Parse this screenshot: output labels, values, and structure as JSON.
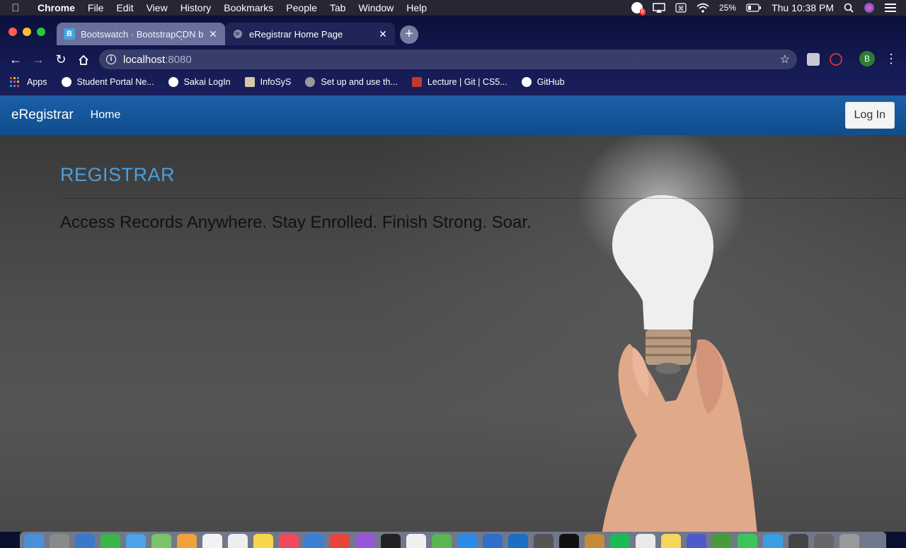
{
  "menubar": {
    "app": "Chrome",
    "items": [
      "File",
      "Edit",
      "View",
      "History",
      "Bookmarks",
      "People",
      "Tab",
      "Window",
      "Help"
    ],
    "battery": "25%",
    "clock": "Thu 10:38 PM",
    "notification_count": "6"
  },
  "tabs": [
    {
      "title": "Bootswatch · BootstrapCDN by",
      "favicon": "B"
    },
    {
      "title": "eRegistrar Home Page"
    }
  ],
  "toolbar": {
    "url_host": "localhost",
    "url_port": ":8080",
    "profile_initial": "B"
  },
  "bookmarks": [
    "Apps",
    "Student Portal Ne...",
    "Sakai LogIn",
    "InfoSyS",
    "Set up and use th...",
    "Lecture | Git | CS5...",
    "GitHub"
  ],
  "site": {
    "brand": "eRegistrar",
    "nav_home": "Home",
    "login": "Log In",
    "heading": "REGISTRAR",
    "tagline": "Access Records Anywhere. Stay Enrolled. Finish Strong. Soar."
  },
  "colors": {
    "navbar": "#1a5c9e",
    "heading": "#4a9fe0",
    "chrome_bg": "#0b0f3a"
  }
}
